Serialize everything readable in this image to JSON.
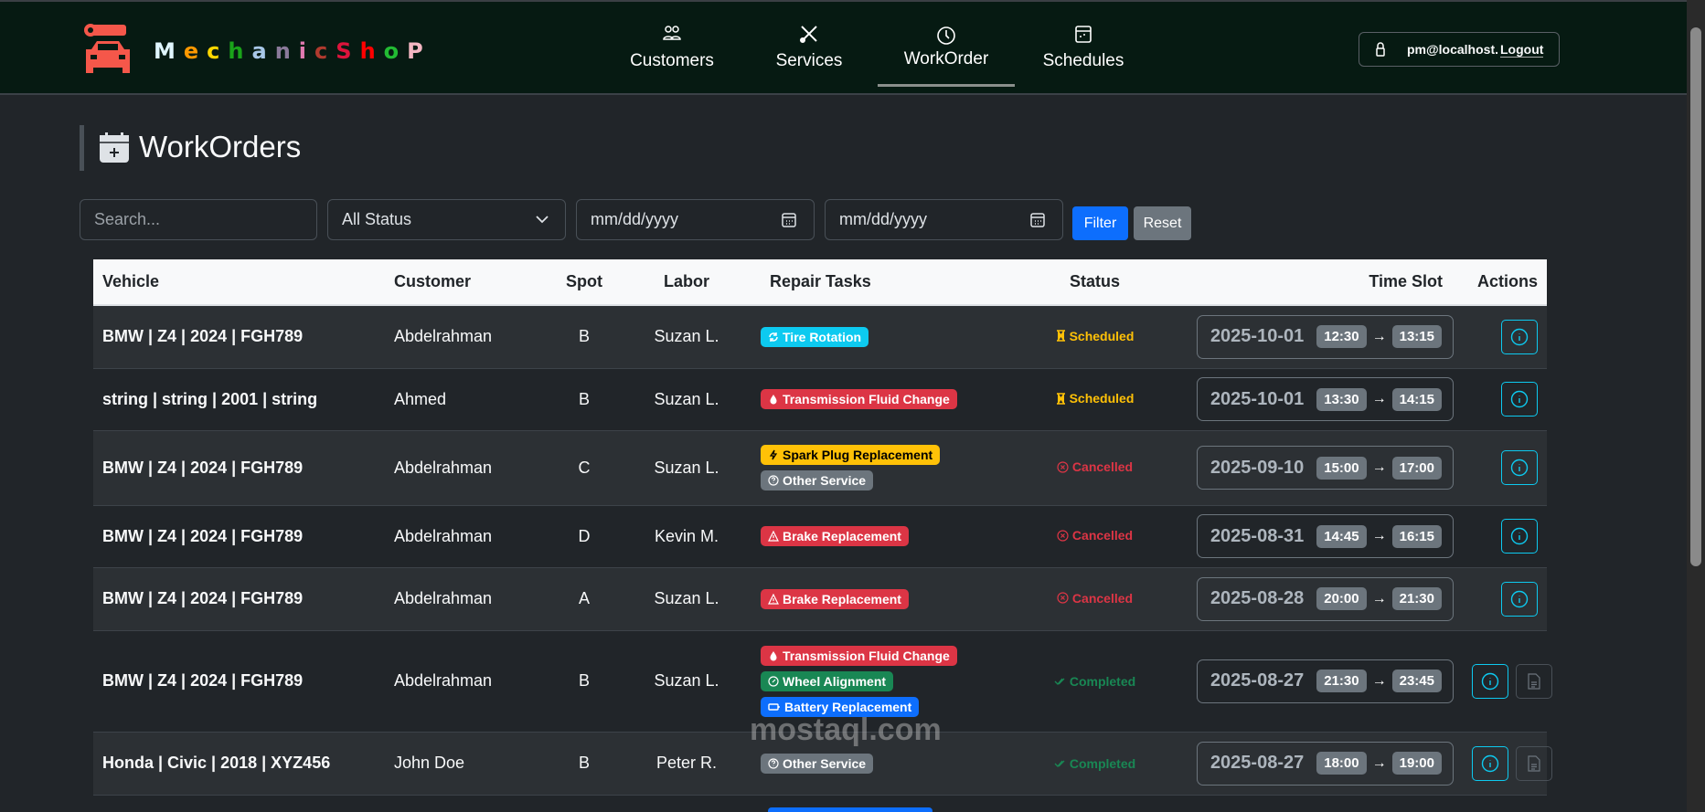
{
  "brand": {
    "letters": [
      {
        "ch": "M",
        "color": "#e0f7ff"
      },
      {
        "ch": "e",
        "color": "#ff9900"
      },
      {
        "ch": "c",
        "color": "#ffd800"
      },
      {
        "ch": "h",
        "color": "#1aa31a"
      },
      {
        "ch": "a",
        "color": "#a8c8e8"
      },
      {
        "ch": "n",
        "color": "#8a7a9a"
      },
      {
        "ch": "i",
        "color": "#e07ab0"
      },
      {
        "ch": "c",
        "color": "#b03a2e"
      },
      {
        "ch": "S",
        "color": "#dc143c"
      },
      {
        "ch": "h",
        "color": "#ff0000"
      },
      {
        "ch": "o",
        "color": "#22bb33"
      },
      {
        "ch": "P",
        "color": "#f4b6c2"
      }
    ],
    "logo_color": "#f5574a"
  },
  "nav": [
    {
      "label": "Customers",
      "icon": "people-icon"
    },
    {
      "label": "Services",
      "icon": "tools-icon"
    },
    {
      "label": "WorkOrder",
      "icon": "clock-icon",
      "active": true
    },
    {
      "label": "Schedules",
      "icon": "calendar-icon"
    }
  ],
  "user": {
    "email": "pm@localhost.",
    "logout": "Logout"
  },
  "page": {
    "title": "WorkOrders"
  },
  "filters": {
    "search_placeholder": "Search...",
    "status_value": "All Status",
    "date_from_placeholder": "mm/dd/yyyy",
    "date_to_placeholder": "mm/dd/yyyy",
    "filter_label": "Filter",
    "reset_label": "Reset"
  },
  "colors": {
    "primary": "#0d6efd",
    "secondary": "#6c757d",
    "info": "#0dcaf0",
    "danger": "#dc3545",
    "warning": "#ffc107",
    "success": "#198754",
    "scheduled": "#ffc107",
    "cancelled": "#dc3545",
    "completed": "#198754"
  },
  "table": {
    "headers": [
      "Vehicle",
      "Customer",
      "Spot",
      "Labor",
      "Repair Tasks",
      "Status",
      "Time Slot",
      "Actions"
    ],
    "rows": [
      {
        "vehicle": "BMW | Z4 | 2024 | FGH789",
        "customer": "Abdelrahman",
        "spot": "B",
        "labor": "Suzan L.",
        "tasks": [
          {
            "label": "Tire Rotation",
            "icon": "rotate-icon",
            "color": "info"
          }
        ],
        "status": "Scheduled",
        "date": "2025-10-01",
        "start": "12:30",
        "end": "13:15",
        "report": false
      },
      {
        "vehicle": "string | string | 2001 | string",
        "customer": "Ahmed",
        "spot": "B",
        "labor": "Suzan L.",
        "tasks": [
          {
            "label": "Transmission Fluid Change",
            "icon": "droplet-icon",
            "color": "danger"
          }
        ],
        "status": "Scheduled",
        "date": "2025-10-01",
        "start": "13:30",
        "end": "14:15",
        "report": false
      },
      {
        "vehicle": "BMW | Z4 | 2024 | FGH789",
        "customer": "Abdelrahman",
        "spot": "C",
        "labor": "Suzan L.",
        "tasks": [
          {
            "label": "Spark Plug Replacement",
            "icon": "lightning-icon",
            "color": "warning"
          },
          {
            "label": "Other Service",
            "icon": "question-icon",
            "color": "secondary"
          }
        ],
        "status": "Cancelled",
        "date": "2025-09-10",
        "start": "15:00",
        "end": "17:00",
        "report": false
      },
      {
        "vehicle": "BMW | Z4 | 2024 | FGH789",
        "customer": "Abdelrahman",
        "spot": "D",
        "labor": "Kevin M.",
        "tasks": [
          {
            "label": "Brake Replacement",
            "icon": "warning-icon",
            "color": "danger"
          }
        ],
        "status": "Cancelled",
        "date": "2025-08-31",
        "start": "14:45",
        "end": "16:15",
        "report": false
      },
      {
        "vehicle": "BMW | Z4 | 2024 | FGH789",
        "customer": "Abdelrahman",
        "spot": "A",
        "labor": "Suzan L.",
        "tasks": [
          {
            "label": "Brake Replacement",
            "icon": "warning-icon",
            "color": "danger"
          }
        ],
        "status": "Cancelled",
        "date": "2025-08-28",
        "start": "20:00",
        "end": "21:30",
        "report": false
      },
      {
        "vehicle": "BMW | Z4 | 2024 | FGH789",
        "customer": "Abdelrahman",
        "spot": "B",
        "labor": "Suzan L.",
        "tasks": [
          {
            "label": "Transmission Fluid Change",
            "icon": "droplet-icon",
            "color": "danger"
          },
          {
            "label": "Wheel Alignment",
            "icon": "compass-icon",
            "color": "success"
          },
          {
            "label": "Battery Replacement",
            "icon": "battery-icon",
            "color": "primary"
          }
        ],
        "status": "Completed",
        "date": "2025-08-27",
        "start": "21:30",
        "end": "23:45",
        "report": true
      },
      {
        "vehicle": "Honda | Civic | 2018 | XYZ456",
        "customer": "John Doe",
        "spot": "B",
        "labor": "Peter R.",
        "tasks": [
          {
            "label": "Other Service",
            "icon": "question-icon",
            "color": "secondary"
          }
        ],
        "status": "Completed",
        "date": "2025-08-27",
        "start": "18:00",
        "end": "19:00",
        "report": true
      }
    ]
  },
  "watermark": "mostaql.com"
}
